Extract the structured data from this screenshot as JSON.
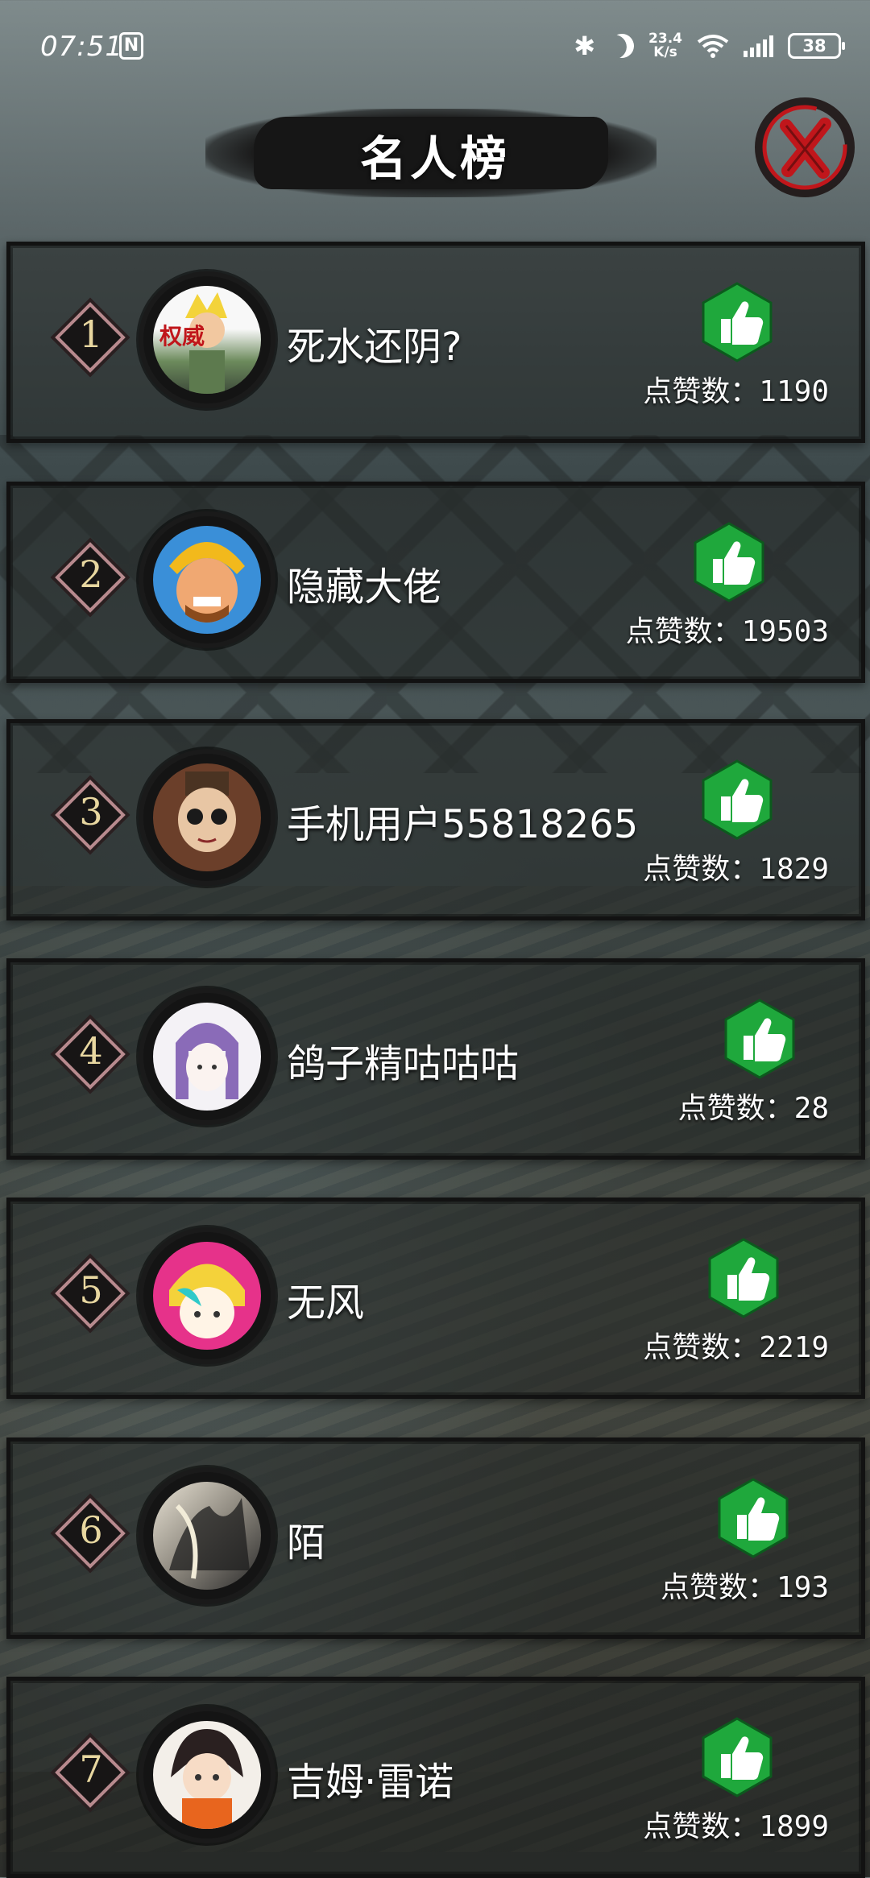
{
  "status_bar": {
    "time": "07:51",
    "nfc": "N",
    "speed_value": "23.4",
    "speed_unit": "K/s",
    "battery": "38"
  },
  "header": {
    "title": "名人榜"
  },
  "leaderboard": {
    "like_label": "点赞数：",
    "entries": [
      {
        "rank": "1",
        "name": "死水还阴?",
        "likes": "1190",
        "avatar_stamp": "权威"
      },
      {
        "rank": "2",
        "name": "隐藏大佬",
        "likes": "19503"
      },
      {
        "rank": "3",
        "name": "手机用户55818265",
        "likes": "1829"
      },
      {
        "rank": "4",
        "name": "鸽子精咕咕咕",
        "likes": "28"
      },
      {
        "rank": "5",
        "name": "无风",
        "likes": "2219"
      },
      {
        "rank": "6",
        "name": "陌",
        "likes": "193"
      },
      {
        "rank": "7",
        "name": "吉姆·雷诺",
        "likes": "1899"
      }
    ]
  },
  "colors": {
    "like_green": "#1fa83c",
    "close_red": "#c0161b",
    "rank_gold": "#e8d7a0"
  }
}
